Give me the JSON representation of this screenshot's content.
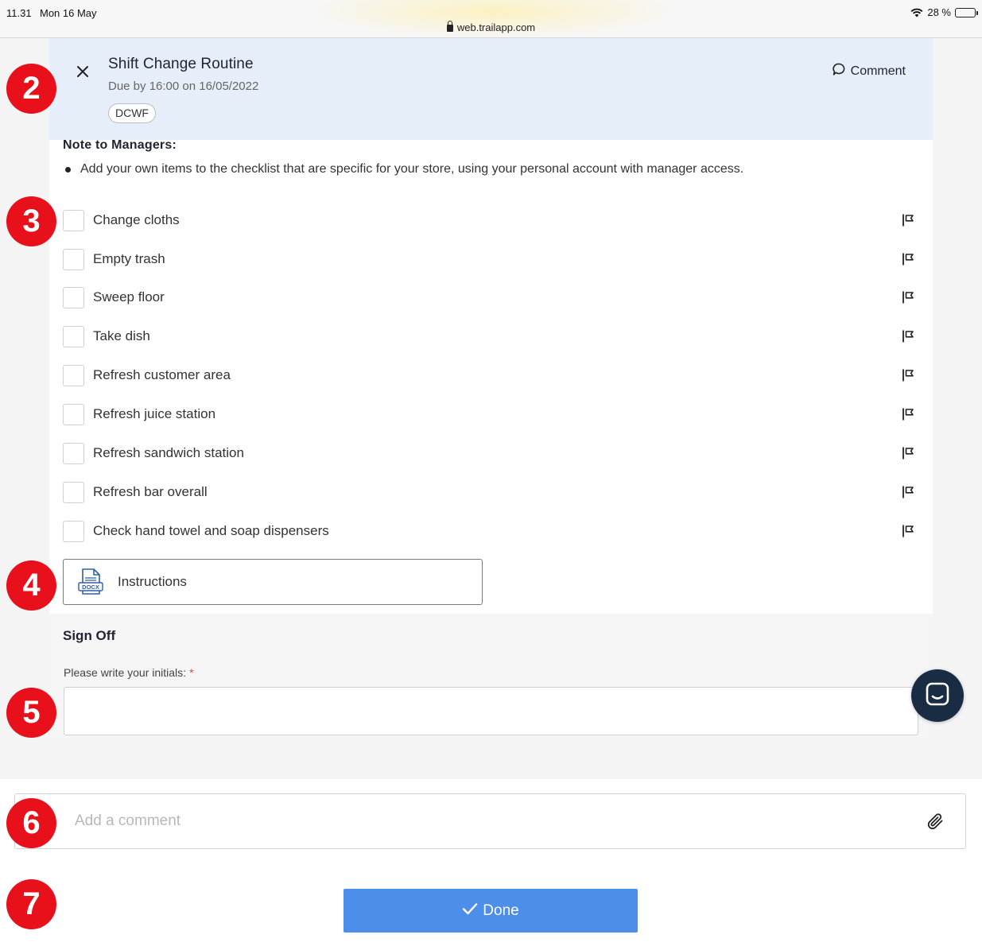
{
  "status_bar": {
    "time": "11.31",
    "date": "Mon 16 May",
    "url": "web.trailapp.com",
    "battery": "28 %",
    "battery_level": 0.28
  },
  "task": {
    "title": "Shift Change Routine",
    "due": "Due by 16:00 on 16/05/2022",
    "tag": "DCWF",
    "comment_label": "Comment"
  },
  "note": {
    "title": "Note to Managers:",
    "items": [
      "Add your own items to the checklist that are specific for your store, using your personal account with manager access."
    ]
  },
  "checklist": [
    {
      "label": "Change cloths"
    },
    {
      "label": "Empty trash"
    },
    {
      "label": "Sweep floor"
    },
    {
      "label": "Take dish"
    },
    {
      "label": "Refresh customer area"
    },
    {
      "label": "Refresh juice station"
    },
    {
      "label": "Refresh sandwich station"
    },
    {
      "label": "Refresh bar overall"
    },
    {
      "label": "Check hand towel and soap dispensers"
    }
  ],
  "attachment": {
    "type_label": "DOCX",
    "label": "Instructions"
  },
  "sign_off": {
    "title": "Sign Off",
    "initials_label": "Please write your initials:",
    "required_marker": "*",
    "initials_value": ""
  },
  "comment": {
    "placeholder": "Add a comment"
  },
  "done_label": "Done",
  "annotation_badges": [
    "2",
    "3",
    "4",
    "5",
    "6",
    "7"
  ],
  "colors": {
    "header_bg": "#e6eef9",
    "done_button": "#4d8eea",
    "badge": "#e8101a",
    "chat_bubble": "#1a2b44",
    "required": "#e0463f"
  }
}
